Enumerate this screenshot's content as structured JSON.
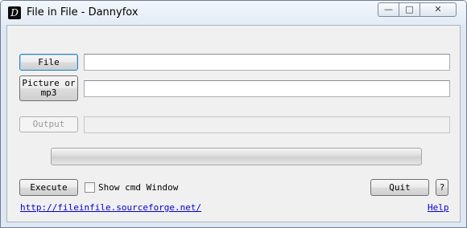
{
  "window": {
    "title": "File in File - Dannyfox",
    "app_icon_glyph": "D",
    "minimize_glyph": "—",
    "maximize_glyph": "□",
    "close_glyph": "✕"
  },
  "form": {
    "file_button": "File",
    "file_value": "",
    "picture_button_line1": "Picture or",
    "picture_button_line2": "mp3",
    "picture_value": "",
    "output_button": "Output",
    "output_value": "",
    "progress_fraction": 0
  },
  "footer": {
    "execute_button": "Execute",
    "show_cmd_label": "Show cmd Window",
    "show_cmd_checked": false,
    "quit_button": "Quit",
    "question_button": "?",
    "website_link": "http://fileinfile.sourceforge.net/",
    "help_link": "Help"
  },
  "colors": {
    "frame": "#dfe8f2",
    "client": "#f0f0f0",
    "link": "#0000cc"
  }
}
